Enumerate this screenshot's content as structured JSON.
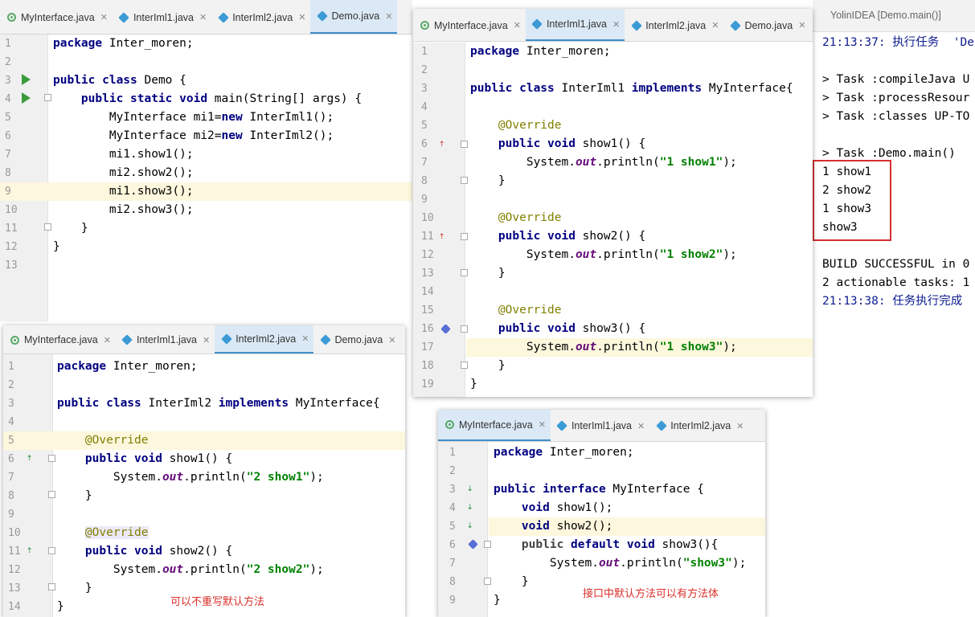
{
  "panel_demo": {
    "tabs": [
      {
        "label": "MyInterface.java",
        "icon": "interface-icon",
        "active": false
      },
      {
        "label": "InterIml1.java",
        "icon": "class-icon",
        "active": false
      },
      {
        "label": "InterIml2.java",
        "icon": "class-icon",
        "active": false
      },
      {
        "label": "Demo.java",
        "icon": "class-icon",
        "active": true
      }
    ],
    "line_numbers": [
      "1",
      "2",
      "3",
      "4",
      "5",
      "6",
      "7",
      "8",
      "9",
      "10",
      "11",
      "12",
      "13"
    ],
    "lines": [
      "package Inter_moren;",
      "",
      "public class Demo {",
      "    public static void main(String[] args) {",
      "        MyInterface mi1=new InterIml1();",
      "        MyInterface mi2=new InterIml2();",
      "        mi1.show1();",
      "        mi2.show2();",
      "        mi1.show3();",
      "        mi2.show3();",
      "    }",
      "}",
      ""
    ]
  },
  "panel_iml1": {
    "tabs": [
      {
        "label": "MyInterface.java",
        "icon": "interface-icon",
        "active": false
      },
      {
        "label": "InterIml1.java",
        "icon": "class-icon",
        "active": true
      },
      {
        "label": "InterIml2.java",
        "icon": "class-icon",
        "active": false
      },
      {
        "label": "Demo.java",
        "icon": "class-icon",
        "active": false
      }
    ],
    "line_numbers": [
      "1",
      "2",
      "3",
      "4",
      "5",
      "6",
      "7",
      "8",
      "9",
      "10",
      "11",
      "12",
      "13",
      "14",
      "15",
      "16",
      "17",
      "18",
      "19"
    ],
    "lines": [
      "package Inter_moren;",
      "",
      "public class InterIml1 implements MyInterface{",
      "",
      "    @Override",
      "    public void show1() {",
      "        System.out.println(\"1 show1\");",
      "    }",
      "",
      "    @Override",
      "    public void show2() {",
      "        System.out.println(\"1 show2\");",
      "    }",
      "",
      "    @Override",
      "    public void show3() {",
      "        System.out.println(\"1 show3\");",
      "    }",
      "}"
    ]
  },
  "panel_iml2": {
    "tabs": [
      {
        "label": "MyInterface.java",
        "icon": "interface-icon",
        "active": false
      },
      {
        "label": "InterIml1.java",
        "icon": "class-icon",
        "active": false
      },
      {
        "label": "InterIml2.java",
        "icon": "class-icon",
        "active": true
      },
      {
        "label": "Demo.java",
        "icon": "class-icon",
        "active": false
      }
    ],
    "line_numbers": [
      "1",
      "2",
      "3",
      "4",
      "5",
      "6",
      "7",
      "8",
      "9",
      "10",
      "11",
      "12",
      "13",
      "14"
    ],
    "lines": [
      "package Inter_moren;",
      "",
      "public class InterIml2 implements MyInterface{",
      "",
      "    @Override",
      "    public void show1() {",
      "        System.out.println(\"2 show1\");",
      "    }",
      "",
      "    @Override",
      "    public void show2() {",
      "        System.out.println(\"2 show2\");",
      "    }",
      "}"
    ],
    "note": "可以不重写默认方法"
  },
  "panel_iface": {
    "tabs": [
      {
        "label": "MyInterface.java",
        "icon": "interface-icon",
        "active": true
      },
      {
        "label": "InterIml1.java",
        "icon": "class-icon",
        "active": false
      },
      {
        "label": "InterIml2.java",
        "icon": "class-icon",
        "active": false
      }
    ],
    "line_numbers": [
      "1",
      "2",
      "3",
      "4",
      "5",
      "6",
      "7",
      "8",
      "9"
    ],
    "lines": [
      "package Inter_moren;",
      "",
      "public interface MyInterface {",
      "    void show1();",
      "    void show2();",
      "    public default void show3(){",
      "        System.out.println(\"show3\");",
      "    }",
      "}"
    ],
    "note": "接口中默认方法可以有方法体"
  },
  "console": {
    "title": "YolinIDEA [Demo.main()]",
    "lines": [
      "21:13:37: 执行任务  'De",
      "",
      "> Task :compileJava U",
      "> Task :processResour",
      "> Task :classes UP-TO",
      "",
      "> Task :Demo.main()",
      "1 show1",
      "2 show2",
      "1 show3",
      "show3",
      "",
      "BUILD SUCCESSFUL in 0",
      "2 actionable tasks: 1",
      "21:13:38: 任务执行完成"
    ],
    "highlight_color": "#d32f2f"
  }
}
